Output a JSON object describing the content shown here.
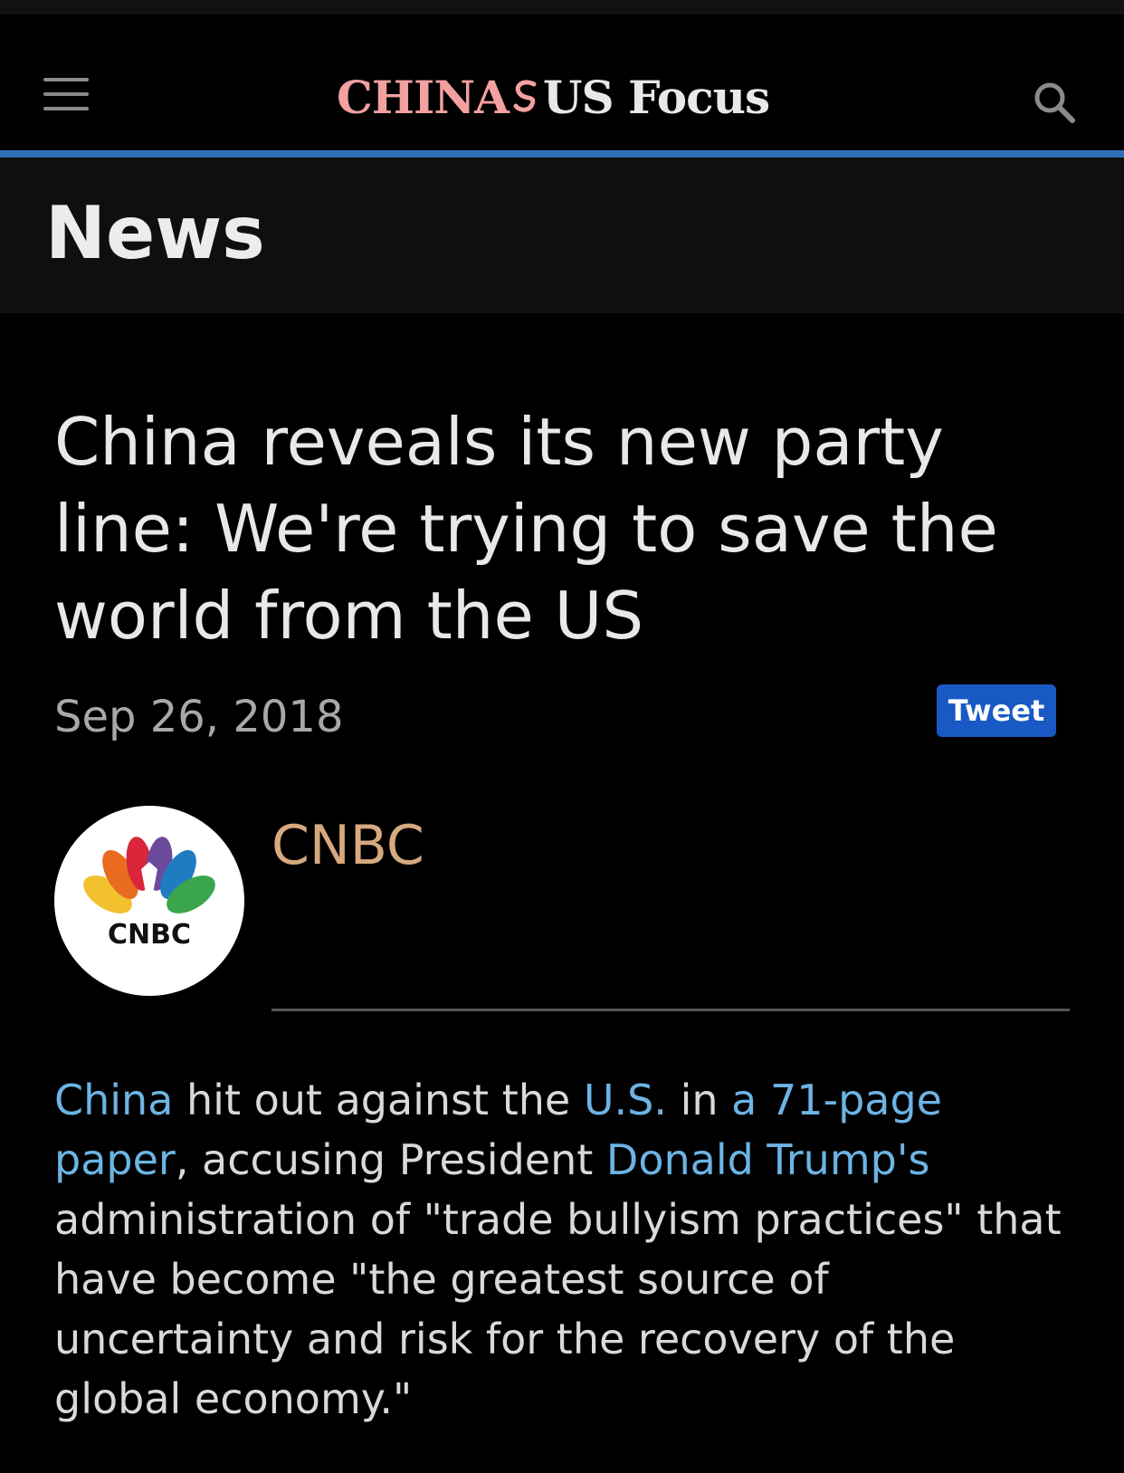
{
  "header": {
    "logo_china": "CHINA",
    "logo_us": "US Focus",
    "menu_icon": "hamburger-icon",
    "search_icon": "search-icon"
  },
  "section": {
    "title": "News"
  },
  "article": {
    "headline": "China reveals its new party line: We're trying to save the world from the US",
    "date": "Sep 26, 2018",
    "tweet_label": "Tweet",
    "source_name": "CNBC",
    "avatar_text": "CNBC",
    "body": {
      "link_china": "China",
      "t1": " hit out against the ",
      "link_us": "U.S.",
      "t2": " in ",
      "link_paper": "a 71-page paper",
      "t3": ", accusing President ",
      "link_trump": "Donald Trump's",
      "t4": " administration of \"trade bullyism practices\" that have become \"the greatest source of uncertainty and risk for the recovery of the global economy.\""
    }
  },
  "colors": {
    "accent_rule": "#2f6fb7",
    "link": "#6cb4e4",
    "source": "#d7a97f",
    "tweet_bg": "#1959c4",
    "logo_china": "#f2a0a0"
  }
}
